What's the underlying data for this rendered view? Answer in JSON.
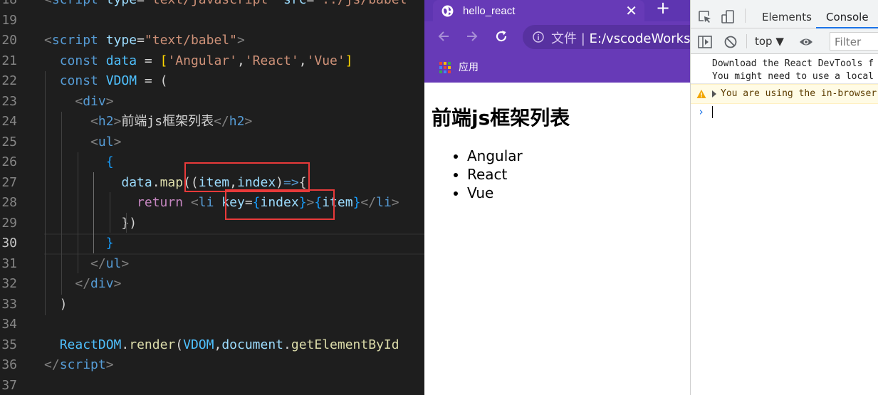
{
  "editor": {
    "lines": [
      {
        "n": "18",
        "tokens": [
          [
            "t-punc",
            "<"
          ],
          [
            "t-tag",
            "script"
          ],
          [
            "t-plain",
            " "
          ],
          [
            "t-attr",
            "type"
          ],
          [
            "t-plain",
            "="
          ],
          [
            "t-str",
            "\"text/javascript\""
          ],
          [
            "t-plain",
            " "
          ],
          [
            "t-attr",
            "src"
          ],
          [
            "t-plain",
            "="
          ],
          [
            "t-str",
            "\"../js/babel"
          ]
        ]
      },
      {
        "n": "19",
        "tokens": []
      },
      {
        "n": "20",
        "tokens": [
          [
            "t-punc",
            "<"
          ],
          [
            "t-tag",
            "script"
          ],
          [
            "t-plain",
            " "
          ],
          [
            "t-attr",
            "type"
          ],
          [
            "t-plain",
            "="
          ],
          [
            "t-str",
            "\"text/babel\""
          ],
          [
            "t-punc",
            ">"
          ]
        ]
      },
      {
        "n": "21",
        "tokens": [
          [
            "t-plain",
            "  "
          ],
          [
            "t-kw",
            "const"
          ],
          [
            "t-plain",
            " "
          ],
          [
            "t-var",
            "data"
          ],
          [
            "t-plain",
            " = "
          ],
          [
            "t-bracket",
            "["
          ],
          [
            "t-str",
            "'Angular'"
          ],
          [
            "t-plain",
            ","
          ],
          [
            "t-str",
            "'React'"
          ],
          [
            "t-plain",
            ","
          ],
          [
            "t-str",
            "'Vue'"
          ],
          [
            "t-bracket",
            "]"
          ]
        ]
      },
      {
        "n": "22",
        "tokens": [
          [
            "t-plain",
            "  "
          ],
          [
            "t-kw",
            "const"
          ],
          [
            "t-plain",
            " "
          ],
          [
            "t-var",
            "VDOM"
          ],
          [
            "t-plain",
            " = ("
          ]
        ]
      },
      {
        "n": "23",
        "tokens": [
          [
            "t-plain",
            "    "
          ],
          [
            "t-punc",
            "<"
          ],
          [
            "t-tag",
            "div"
          ],
          [
            "t-punc",
            ">"
          ]
        ]
      },
      {
        "n": "24",
        "tokens": [
          [
            "t-plain",
            "      "
          ],
          [
            "t-punc",
            "<"
          ],
          [
            "t-tag",
            "h2"
          ],
          [
            "t-punc",
            ">"
          ],
          [
            "t-text",
            "前端js框架列表"
          ],
          [
            "t-punc",
            "</"
          ],
          [
            "t-tag",
            "h2"
          ],
          [
            "t-punc",
            ">"
          ]
        ]
      },
      {
        "n": "25",
        "tokens": [
          [
            "t-plain",
            "      "
          ],
          [
            "t-punc",
            "<"
          ],
          [
            "t-tag",
            "ul"
          ],
          [
            "t-punc",
            ">"
          ]
        ]
      },
      {
        "n": "26",
        "tokens": [
          [
            "t-plain",
            "        "
          ],
          [
            "t-brace",
            "{"
          ]
        ]
      },
      {
        "n": "27",
        "tokens": [
          [
            "t-plain",
            "          "
          ],
          [
            "t-prop",
            "data"
          ],
          [
            "t-plain",
            "."
          ],
          [
            "t-fn",
            "map"
          ],
          [
            "t-plain",
            "(("
          ],
          [
            "t-prop",
            "item"
          ],
          [
            "t-plain",
            ","
          ],
          [
            "t-prop",
            "index"
          ],
          [
            "t-plain",
            ")"
          ],
          [
            "t-kw",
            "=>"
          ],
          [
            "t-plain",
            "{"
          ]
        ]
      },
      {
        "n": "28",
        "tokens": [
          [
            "t-plain",
            "            "
          ],
          [
            "t-ctrl",
            "return"
          ],
          [
            "t-plain",
            " "
          ],
          [
            "t-punc",
            "<"
          ],
          [
            "t-tag",
            "li"
          ],
          [
            "t-plain",
            " "
          ],
          [
            "t-attr",
            "key"
          ],
          [
            "t-plain",
            "="
          ],
          [
            "t-brace",
            "{"
          ],
          [
            "t-prop",
            "index"
          ],
          [
            "t-brace",
            "}"
          ],
          [
            "t-punc",
            ">"
          ],
          [
            "t-brace",
            "{"
          ],
          [
            "t-prop",
            "item"
          ],
          [
            "t-brace",
            "}"
          ],
          [
            "t-punc",
            "</"
          ],
          [
            "t-tag",
            "li"
          ],
          [
            "t-punc",
            ">"
          ]
        ]
      },
      {
        "n": "29",
        "tokens": [
          [
            "t-plain",
            "          })"
          ]
        ]
      },
      {
        "n": "30",
        "tokens": [
          [
            "t-plain",
            "        "
          ],
          [
            "t-brace",
            "}"
          ]
        ]
      },
      {
        "n": "31",
        "tokens": [
          [
            "t-plain",
            "      "
          ],
          [
            "t-punc",
            "</"
          ],
          [
            "t-tag",
            "ul"
          ],
          [
            "t-punc",
            ">"
          ]
        ]
      },
      {
        "n": "32",
        "tokens": [
          [
            "t-plain",
            "    "
          ],
          [
            "t-punc",
            "</"
          ],
          [
            "t-tag",
            "div"
          ],
          [
            "t-punc",
            ">"
          ]
        ]
      },
      {
        "n": "33",
        "tokens": [
          [
            "t-plain",
            "  )"
          ]
        ]
      },
      {
        "n": "34",
        "tokens": []
      },
      {
        "n": "35",
        "tokens": [
          [
            "t-plain",
            "  "
          ],
          [
            "t-var",
            "ReactDOM"
          ],
          [
            "t-plain",
            "."
          ],
          [
            "t-fn",
            "render"
          ],
          [
            "t-plain",
            "("
          ],
          [
            "t-var",
            "VDOM"
          ],
          [
            "t-plain",
            ","
          ],
          [
            "t-prop",
            "document"
          ],
          [
            "t-plain",
            "."
          ],
          [
            "t-fn",
            "getElementById"
          ]
        ]
      },
      {
        "n": "36",
        "tokens": [
          [
            "t-punc",
            "</"
          ],
          [
            "t-tag",
            "script"
          ],
          [
            "t-punc",
            ">"
          ]
        ]
      },
      {
        "n": "37",
        "tokens": []
      }
    ],
    "active_line": "30",
    "highlight_color": "#e83a3a"
  },
  "browser": {
    "tab_title": "hello_react",
    "tab_close": "✕",
    "new_tab": "+",
    "address_prefix": "文件",
    "address_separator": "|",
    "address_url": "E:/vscodeWorksp",
    "bookmark_apps": "应用",
    "theme_color": "#673ab7",
    "page": {
      "heading": "前端js框架列表",
      "items": [
        "Angular",
        "React",
        "Vue"
      ]
    }
  },
  "devtools": {
    "tabs": [
      "Elements",
      "Console"
    ],
    "active_tab": "Console",
    "context": "top ▼",
    "filter_placeholder": "Filter",
    "messages": {
      "info_line1": "Download the React DevTools f",
      "info_line2": "You might need to use a local",
      "warning": "You are using the in-browser"
    },
    "prompt": "›"
  }
}
